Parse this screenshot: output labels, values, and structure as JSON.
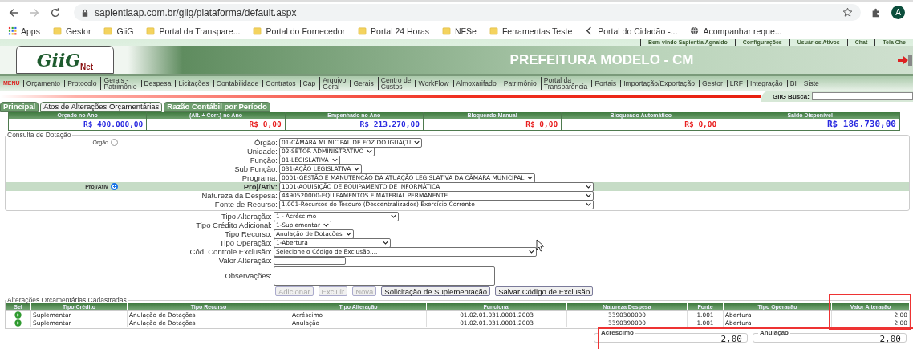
{
  "browser": {
    "url": "sapientiaap.com.br/giig/plataforma/default.aspx",
    "profile_initial": "A",
    "bookmarks": [
      {
        "label": "Apps",
        "kind": "apps"
      },
      {
        "label": "Gestor",
        "kind": "folder"
      },
      {
        "label": "GiiG",
        "kind": "folder"
      },
      {
        "label": "Portal da Transpare...",
        "kind": "folder"
      },
      {
        "label": "Portal do Fornecedor",
        "kind": "folder"
      },
      {
        "label": "Portal 24 Horas",
        "kind": "folder"
      },
      {
        "label": "NFSe",
        "kind": "folder"
      },
      {
        "label": "Ferramentas Teste",
        "kind": "folder"
      },
      {
        "label": "Portal do Cidadão -...",
        "kind": "chevron"
      },
      {
        "label": "Acompanhar reque...",
        "kind": "globe"
      }
    ]
  },
  "site": {
    "top_links": [
      "Bem vindo Sapientia.Agnaldo",
      "Configurações",
      "Usuários Ativos",
      "Chat",
      "Tela Che"
    ],
    "logo": "GiiG",
    "logo_sub": "Net",
    "title": "PREFEITURA MODELO - CM",
    "menu_label": "MENU",
    "menu": [
      "Orçamento",
      "Protocolo",
      "Gerais -\nPatrimônio",
      "Despesa",
      "Licitações",
      "Contabilidade",
      "Contratos",
      "Cap",
      "Arquivo\nGeral",
      "Gerais",
      "Centro de\nCustos",
      "WorkFlow",
      "Almoxarifado",
      "Patrimônio",
      "Portal da\nTransparência",
      "Portais",
      "Importação/Exportação",
      "Gestor",
      "LRF",
      "Integração",
      "BI",
      "Siste"
    ],
    "search_label": "GiiG Busca:"
  },
  "tabs": [
    {
      "label": "Principal",
      "selected": false
    },
    {
      "label": "Atos de Alterações Orçamentárias",
      "selected": true
    },
    {
      "label": "Razão Contábil por Período",
      "selected": false
    }
  ],
  "summary": [
    {
      "label": "Orçado no Ano",
      "value": "R$ 400.000,00",
      "color": "#2a2ae0"
    },
    {
      "label": "(Alt. + Corr.) no Ano",
      "value": "R$ 0,00",
      "color": "#e82020"
    },
    {
      "label": "Empenhado no Ano",
      "value": "R$ 213.270,00",
      "color": "#2a2ae0"
    },
    {
      "label": "Bloqueado Manual",
      "value": "R$ 0,00",
      "color": "#e82020"
    },
    {
      "label": "Bloqueado Automático",
      "value": "R$ 0,00",
      "color": "#e82020"
    },
    {
      "label": "Saldo Disponível",
      "value": "R$ 186.730,00",
      "color": "#2a2ae0"
    }
  ],
  "consulta": {
    "legend": "Consulta de Dotação",
    "fields": [
      {
        "label": "Órgão:",
        "value": "01-CÂMARA MUNICIPAL DE FOZ DO IGUAÇU",
        "kind": "select",
        "radio": {
          "label": "Orgão",
          "selected": false
        }
      },
      {
        "label": "Unidade:",
        "value": "02-SETOR ADMINISTRATIVO",
        "kind": "select"
      },
      {
        "label": "Função:",
        "value": "01-LEGISLATIVA",
        "kind": "select"
      },
      {
        "label": "Sub Função:",
        "value": "031-AÇÃO LEGISLATIVA",
        "kind": "select"
      },
      {
        "label": "Programa:",
        "value": "0001-GESTÃO E MANUTENÇÃO DA ATUAÇÃO LEGISLATIVA DA CÂMARA MUNICIPAL",
        "kind": "select"
      },
      {
        "label": "Proj/Ativ:",
        "value": "1001-AQUISIÇÃO DE EQUIPAMENTO DE INFORMÁTICA",
        "kind": "wide",
        "radio": {
          "label": "Proj/Ativ",
          "selected": true
        }
      },
      {
        "label": "Natureza da Despesa:",
        "value": "4490520000-EQUIPAMENTOS E MATERIAL PERMANENTE",
        "kind": "wide"
      },
      {
        "label": "Fonte de Recurso:",
        "value": "1.001-Recursos do Tesouro (Descentralizados) Exercício Corrente",
        "kind": "wide"
      }
    ]
  },
  "form": [
    {
      "label": "Tipo Alteração:",
      "value": "1 - Acréscimo",
      "kind": "select"
    },
    {
      "label": "Tipo Crédito Adicional:",
      "value": "1-Suplementar",
      "kind": "select"
    },
    {
      "label": "Tipo Recurso:",
      "value": "Anulação de Dotações",
      "kind": "select"
    },
    {
      "label": "Tipo Operação:",
      "value": "1-Abertura",
      "kind": "select"
    },
    {
      "label": "Cód. Controle Exclusão:",
      "value": "Selecione o Código de Exclusão....",
      "kind": "select"
    },
    {
      "label": "Valor Alteração:",
      "kind": "input"
    },
    {
      "label": "Observações:",
      "kind": "textarea"
    }
  ],
  "buttons": [
    {
      "label": "Adicionar",
      "disabled": true
    },
    {
      "label": "Excluir",
      "disabled": true
    },
    {
      "label": "Nova",
      "disabled": true
    },
    {
      "label": "Solicitação de Suplementação",
      "disabled": false
    },
    {
      "label": "Salvar Código de Exclusão",
      "disabled": false
    }
  ],
  "table": {
    "legend": "Alterações Orçamentárias Cadastradas",
    "select_header": "Sel",
    "columns": [
      "Tipo Crédito",
      "Tipo Recurso",
      "Tipo Alteração",
      "Funcional",
      "Natureza Despesa",
      "Fonte",
      "Tipo Operação",
      "Valor Alteração"
    ],
    "rows": [
      [
        "Suplementar",
        "Anulação de Dotações",
        "Acréscimo",
        "01.02.01.031.0001.2003",
        "3390300000",
        "1.001",
        "Abertura",
        "2,00"
      ],
      [
        "Suplementar",
        "Anulação de Dotações",
        "Anulação",
        "01.02.01.031.0001.2003",
        "3390390000",
        "1.001",
        "Abertura",
        "2,00"
      ]
    ]
  },
  "totals": [
    {
      "label": "Acréscimo",
      "value": "2,00"
    },
    {
      "label": "Anulação",
      "value": "2,00"
    }
  ]
}
